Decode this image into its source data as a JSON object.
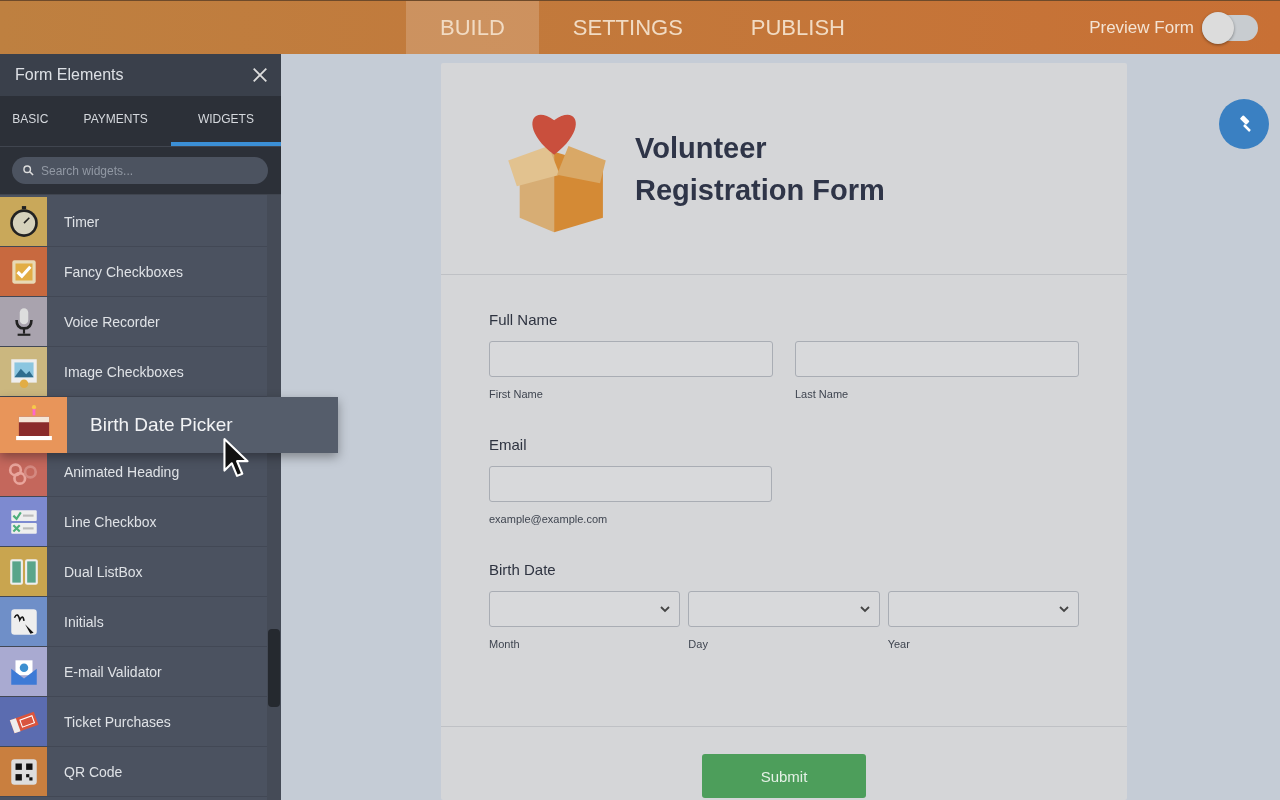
{
  "top_nav": {
    "tabs": [
      {
        "label": "BUILD",
        "selected": true
      },
      {
        "label": "SETTINGS",
        "selected": false
      },
      {
        "label": "PUBLISH",
        "selected": false
      }
    ],
    "preview": {
      "label": "Preview Form",
      "on": false
    }
  },
  "sidebar": {
    "title": "Form Elements",
    "tabs": [
      {
        "label": "BASIC",
        "selected": false
      },
      {
        "label": "PAYMENTS",
        "selected": false
      },
      {
        "label": "WIDGETS",
        "selected": true
      }
    ],
    "search": {
      "placeholder": "Search widgets..."
    },
    "items": [
      {
        "label": "Timer",
        "kind": "timer",
        "color": "#c9a85a"
      },
      {
        "label": "Fancy Checkboxes",
        "kind": "checkbox",
        "color": "#c8693f"
      },
      {
        "label": "Voice Recorder",
        "kind": "mic",
        "color": "#a9a3ae"
      },
      {
        "label": "Image Checkboxes",
        "kind": "image",
        "color": "#cbb77f"
      },
      {
        "label": "Birth Date Picker",
        "kind": "cake",
        "color": "#e8955a",
        "dragging": true
      },
      {
        "label": "Animated Heading",
        "kind": "cool",
        "color": "#c4675c"
      },
      {
        "label": "Line Checkbox",
        "kind": "lines",
        "color": "#7d8ad0"
      },
      {
        "label": "Dual ListBox",
        "kind": "dual",
        "color": "#c9a54f"
      },
      {
        "label": "Initials",
        "kind": "initials",
        "color": "#6f8fc8"
      },
      {
        "label": "E-mail Validator",
        "kind": "mail",
        "color": "#a9aad1"
      },
      {
        "label": "Ticket Purchases",
        "kind": "ticket",
        "color": "#5b6cb0"
      },
      {
        "label": "QR Code",
        "kind": "qr",
        "color": "#c97f3f"
      }
    ]
  },
  "form": {
    "title_lines": [
      "Volunteer",
      "Registration Form"
    ],
    "fields": [
      {
        "kind": "name",
        "label": "Full Name",
        "sublabels": [
          "First Name",
          "Last Name"
        ]
      },
      {
        "kind": "email",
        "label": "Email",
        "sublabels": [
          "example@example.com"
        ]
      },
      {
        "kind": "date",
        "label": "Birth Date",
        "sublabels": [
          "Month",
          "Day",
          "Year"
        ]
      }
    ],
    "submit": "Submit"
  }
}
